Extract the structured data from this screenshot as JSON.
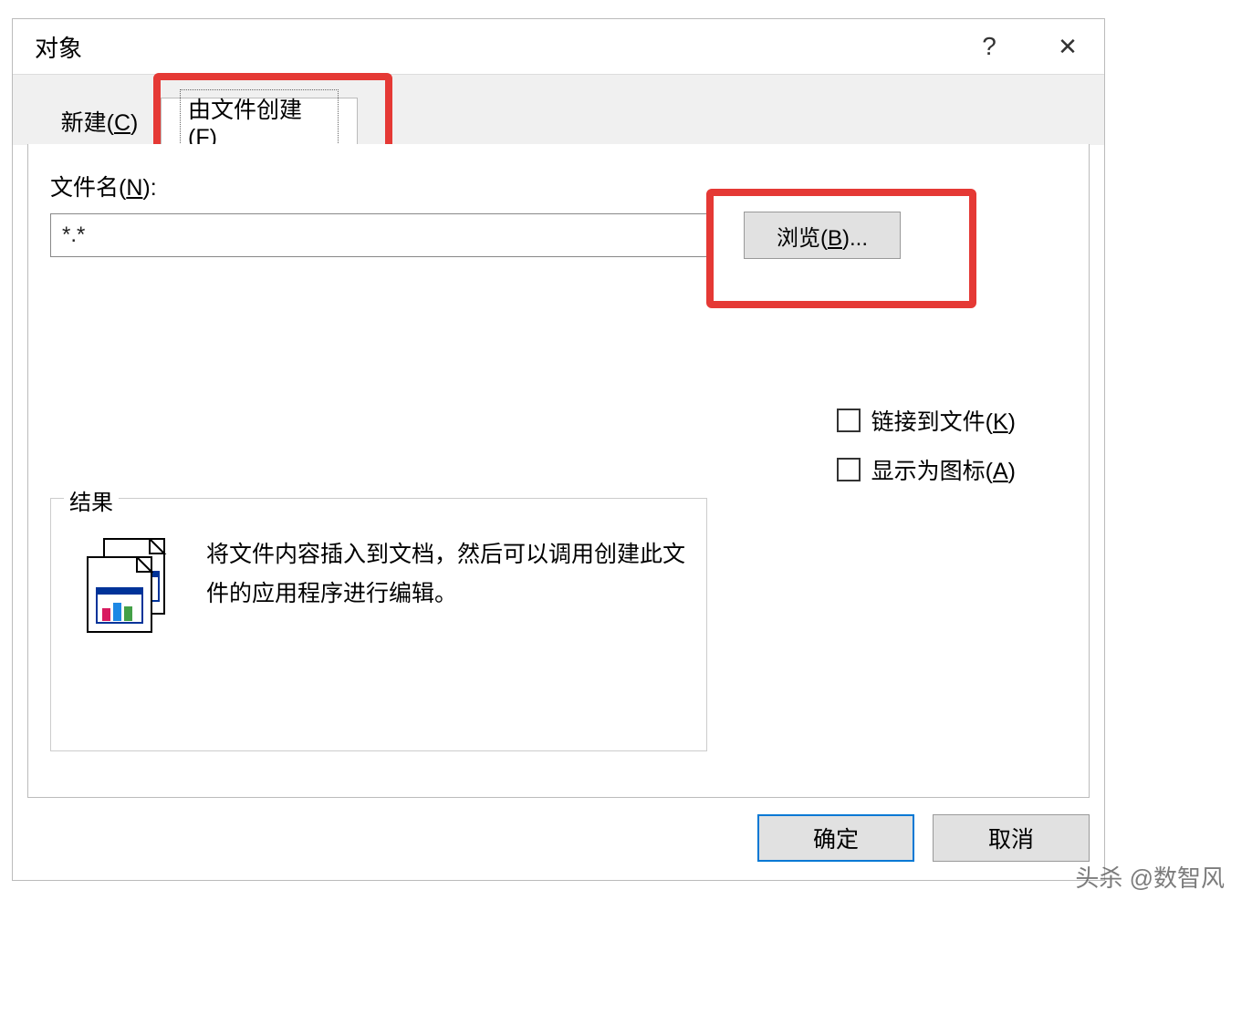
{
  "titlebar": {
    "title": "对象",
    "help_symbol": "?",
    "close_symbol": "✕"
  },
  "tabs": {
    "new_label": "新建(",
    "new_hotkey": "C",
    "new_suffix": ")",
    "fromfile_label": "由文件创建(",
    "fromfile_hotkey": "F",
    "fromfile_suffix": ")"
  },
  "filename": {
    "label_prefix": "文件名(",
    "label_hotkey": "N",
    "label_suffix": "):",
    "value": "*.*"
  },
  "browse": {
    "label_prefix": "浏览(",
    "label_hotkey": "B",
    "label_suffix": ")..."
  },
  "checkboxes": {
    "link_prefix": "链接到文件(",
    "link_hotkey": "K",
    "link_suffix": ")",
    "icon_prefix": "显示为图标(",
    "icon_hotkey": "A",
    "icon_suffix": ")"
  },
  "result": {
    "label": "结果",
    "description": "将文件内容插入到文档，然后可以调用创建此文件的应用程序进行编辑。"
  },
  "buttons": {
    "ok": "确定",
    "cancel": "取消"
  },
  "watermark": "头杀 @数智风"
}
